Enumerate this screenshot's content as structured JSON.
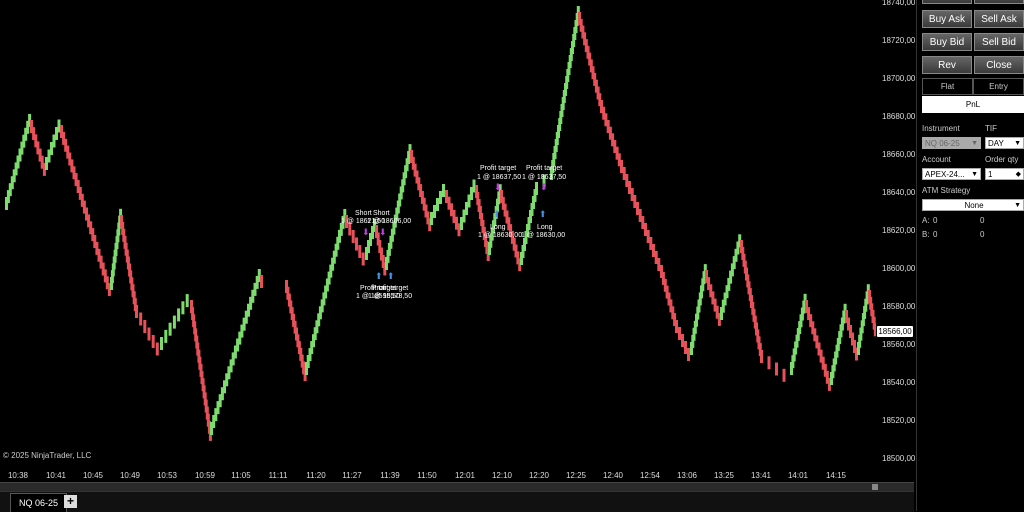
{
  "chart": {
    "instrument_tab": "NQ 06-25",
    "add_tab": "+",
    "copyright": "© 2025 NinjaTrader, LLC",
    "current_price": "18566,00",
    "price_labels": [
      "18740,00",
      "18720,00",
      "18700,00",
      "18680,00",
      "18660,00",
      "18640,00",
      "18620,00",
      "18600,00",
      "18580,00",
      "18560,00",
      "18540,00",
      "18520,00",
      "18500,00"
    ],
    "time_labels": [
      "10:38",
      "10:41",
      "10:45",
      "10:49",
      "10:53",
      "10:59",
      "11:05",
      "11:11",
      "11:20",
      "11:27",
      "11:39",
      "11:50",
      "12:01",
      "12:10",
      "12:20",
      "12:25",
      "12:40",
      "12:54",
      "13:06",
      "13:25",
      "13:41",
      "14:01",
      "14:15"
    ],
    "annotations": {
      "short_a": "Short",
      "short_b": "Short",
      "short_price_a": "1 @ 18621,50",
      "short_price_b": "1 @ 18606,00",
      "pt_a": "Profit target",
      "pt_b": "Profit target",
      "pt_price_a": "1 @ 18595,50",
      "pt_price_b": "1 @ 18578,50",
      "pt_top_a": "Profit target",
      "pt_top_b": "Profit target",
      "pt_top_price_a": "1 @ 18637,50",
      "pt_top_price_b": "1 @ 18637,50",
      "long_a": "Long",
      "long_b": "Long",
      "long_price_a": "1 @ 18630,00",
      "long_price_b": "1 @ 18630,00"
    },
    "colors": {
      "up": "#7ddc6e",
      "down": "#e8505a",
      "background": "#000000"
    }
  },
  "panel": {
    "buy_ask": "Buy Ask",
    "sell_ask": "Sell Ask",
    "buy_bid": "Buy Bid",
    "sell_bid": "Sell Bid",
    "rev": "Rev",
    "close": "Close",
    "flat": "Flat",
    "entry": "Entry",
    "pnl": "PnL",
    "instrument_label": "Instrument",
    "instrument_value": "NQ 06-25",
    "tif_label": "TIF",
    "tif_value": "DAY",
    "account_label": "Account",
    "account_value": "APEX-24...",
    "order_qty_label": "Order qty",
    "order_qty_value": "1",
    "atm_label": "ATM Strategy",
    "atm_value": "None",
    "a_label": "A:",
    "a_val1": "0",
    "a_val2": "0",
    "b_label": "B:",
    "b_val1": "0",
    "b_val2": "0"
  }
}
